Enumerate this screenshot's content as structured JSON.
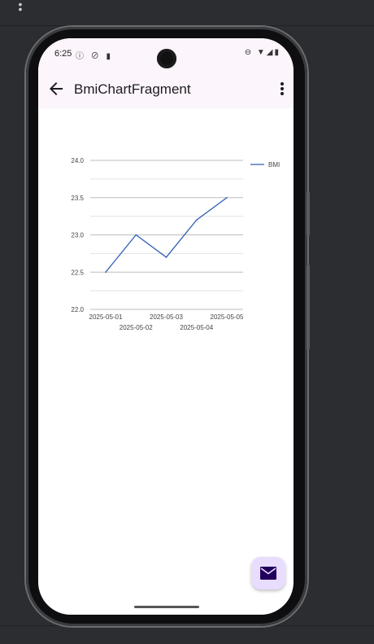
{
  "status_bar": {
    "time": "6:25"
  },
  "app_bar": {
    "title": "BmiChartFragment"
  },
  "chart_data": {
    "type": "line",
    "x": [
      "2025-05-01",
      "2025-05-02",
      "2025-05-03",
      "2025-05-04",
      "2025-05-05"
    ],
    "series": [
      {
        "name": "BMI",
        "values": [
          22.5,
          23.0,
          22.7,
          23.2,
          23.5
        ],
        "color": "#2f5fb3"
      }
    ],
    "yticks": [
      "22.0",
      "22.5",
      "23.0",
      "23.5",
      "24.0"
    ],
    "ylim": [
      22.0,
      24.0
    ],
    "grid": true,
    "legend_position": "right"
  },
  "colors": {
    "accent": "#e8ddff",
    "app_bar_bg": "#fcf5fb",
    "line": "#2f5fb3"
  },
  "icons": {
    "back": "arrow-back-icon",
    "overflow": "more-vert-icon",
    "fab": "email-icon"
  }
}
